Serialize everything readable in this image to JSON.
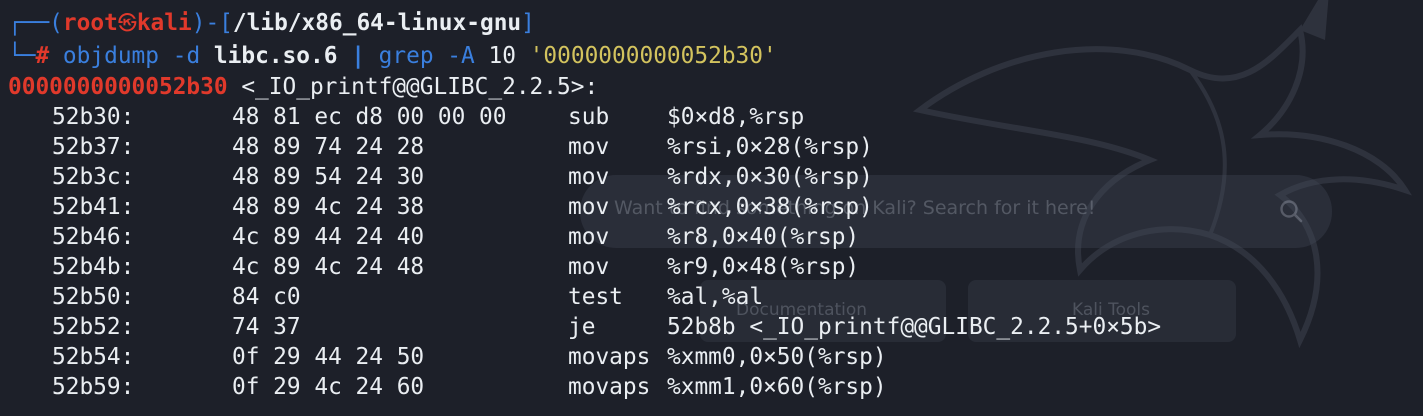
{
  "prompt": {
    "open_bracket_left": "┌──(",
    "user": "root",
    "skull": "㉿",
    "host": "kali",
    "separator": ")-[",
    "path": "/lib/x86_64-linux-gnu",
    "close_bracket": "]",
    "second_line_prefix": "└─",
    "hash": "#",
    "cmd": "objdump",
    "arg1": "-d",
    "arg2": "libc.so.6",
    "pipe": "|",
    "cmd2": "grep",
    "arg3": "-A",
    "arg4": "10",
    "arg5": "'0000000000052b30'"
  },
  "output": {
    "symbol_address": "0000000000052b30",
    "symbol_label": " <_IO_printf@@GLIBC_2.2.5>:",
    "rows": [
      {
        "addr": "52b30:",
        "bytes": "48 81 ec d8 00 00 00",
        "mnemonic": "sub",
        "operands": "$0×d8,%rsp"
      },
      {
        "addr": "52b37:",
        "bytes": "48 89 74 24 28",
        "mnemonic": "mov",
        "operands": "%rsi,0×28(%rsp)"
      },
      {
        "addr": "52b3c:",
        "bytes": "48 89 54 24 30",
        "mnemonic": "mov",
        "operands": "%rdx,0×30(%rsp)"
      },
      {
        "addr": "52b41:",
        "bytes": "48 89 4c 24 38",
        "mnemonic": "mov",
        "operands": "%rcx,0×38(%rsp)"
      },
      {
        "addr": "52b46:",
        "bytes": "4c 89 44 24 40",
        "mnemonic": "mov",
        "operands": "%r8,0×40(%rsp)"
      },
      {
        "addr": "52b4b:",
        "bytes": "4c 89 4c 24 48",
        "mnemonic": "mov",
        "operands": "%r9,0×48(%rsp)"
      },
      {
        "addr": "52b50:",
        "bytes": "84 c0",
        "mnemonic": "test",
        "operands": "%al,%al"
      },
      {
        "addr": "52b52:",
        "bytes": "74 37",
        "mnemonic": "je",
        "operands": "52b8b <_IO_printf@@GLIBC_2.2.5+0×5b>"
      },
      {
        "addr": "52b54:",
        "bytes": "0f 29 44 24 50",
        "mnemonic": "movaps",
        "operands": "%xmm0,0×50(%rsp)"
      },
      {
        "addr": "52b59:",
        "bytes": "0f 29 4c 24 60",
        "mnemonic": "movaps",
        "operands": "%xmm1,0×60(%rsp)"
      }
    ]
  },
  "background": {
    "search_text": "Want to find something on Kali? Search for it here!",
    "docs_button": "Documentation",
    "tools_button": "Kali Tools"
  },
  "colors": {
    "background": "#1d2029",
    "prompt_blue": "#3a7fde",
    "prompt_red": "#e0392b",
    "text_white": "#eaeef2",
    "string_yellow": "#d3c35e"
  },
  "icons": {
    "background_logo": "kali-dragon-icon",
    "search": "search-icon"
  }
}
